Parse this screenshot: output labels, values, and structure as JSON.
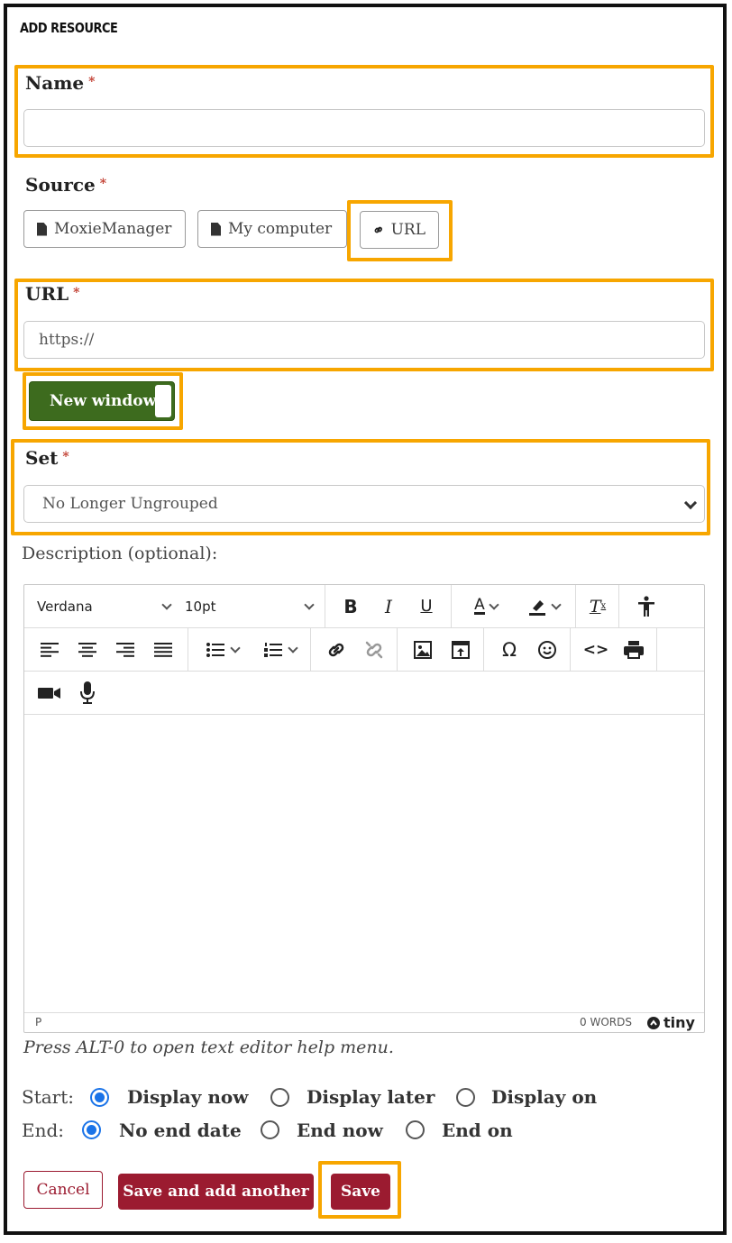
{
  "page": {
    "title": "ADD RESOURCE"
  },
  "name_field": {
    "label": "Name",
    "required_mark": "*",
    "value": "",
    "placeholder": ""
  },
  "source": {
    "label": "Source",
    "required_mark": "*",
    "options": [
      {
        "label": "MoxieManager",
        "icon": "file-icon"
      },
      {
        "label": "My computer",
        "icon": "file-icon"
      },
      {
        "label": "URL",
        "icon": "link-icon"
      }
    ]
  },
  "url_field": {
    "label": "URL",
    "required_mark": "*",
    "placeholder": "https://"
  },
  "new_window": {
    "label": "New window",
    "on": true
  },
  "set_field": {
    "label": "Set",
    "required_mark": "*",
    "selected": "No Longer Ungrouped"
  },
  "description": {
    "label": "Description (optional):",
    "font_family": "Verdana",
    "font_size": "10pt",
    "status_path": "P",
    "word_count": "0 WORDS",
    "brand": "tiny",
    "help_text": "Press ALT-0 to open text editor help menu."
  },
  "start": {
    "label": "Start:",
    "options": [
      {
        "label": "Display now",
        "selected": true
      },
      {
        "label": "Display later",
        "selected": false
      },
      {
        "label": "Display on",
        "selected": false
      }
    ]
  },
  "end": {
    "label": "End:",
    "options": [
      {
        "label": "No end date",
        "selected": true
      },
      {
        "label": "End now",
        "selected": false
      },
      {
        "label": "End on",
        "selected": false
      }
    ]
  },
  "actions": {
    "cancel": "Cancel",
    "save_and_add": "Save and add another",
    "save": "Save"
  },
  "colors": {
    "highlight": "#f7a600",
    "primary": "#9b1b30",
    "toggle_on": "#3d6b1e",
    "radio": "#1a73e8"
  }
}
